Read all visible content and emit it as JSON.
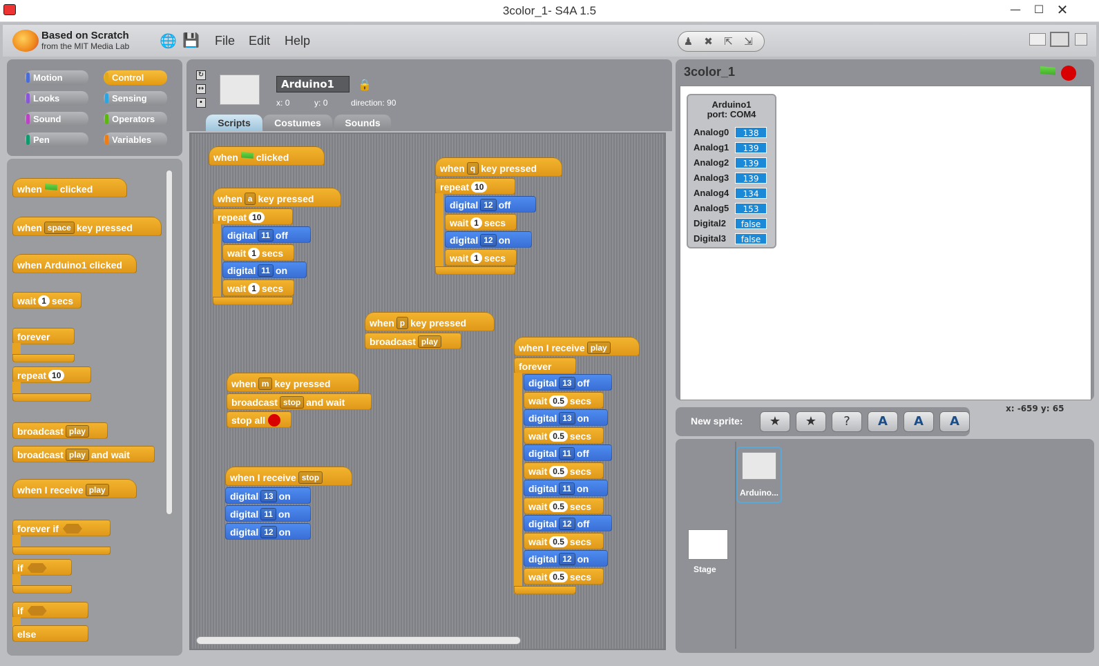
{
  "window": {
    "title": "3color_1- S4A 1.5"
  },
  "menubar": {
    "logo_line1": "Based on Scratch",
    "logo_line2": "from the MIT Media Lab",
    "file": "File",
    "edit": "Edit",
    "help": "Help"
  },
  "categories": {
    "motion": "Motion",
    "control": "Control",
    "looks": "Looks",
    "sensing": "Sensing",
    "sound": "Sound",
    "operators": "Operators",
    "pen": "Pen",
    "variables": "Variables",
    "colors": {
      "motion": "#4a6cd4",
      "control": "#e1a91a",
      "looks": "#8a55d7",
      "sensing": "#2ca5e2",
      "sound": "#bb42c3",
      "operators": "#5cb712",
      "pen": "#0e9a6c",
      "variables": "#ee7d16"
    }
  },
  "sprite": {
    "name": "Arduino1",
    "x_label": "x:",
    "x": "0",
    "y_label": "y:",
    "y": "0",
    "direction_label": "direction:",
    "direction": "90"
  },
  "tabs": {
    "scripts": "Scripts",
    "costumes": "Costumes",
    "sounds": "Sounds"
  },
  "palette": {
    "when": "when",
    "clicked": "clicked",
    "key_pressed": "key pressed",
    "space": "space",
    "when_arduino_clicked": "when Arduino1 clicked",
    "wait": "wait",
    "one": "1",
    "secs": "secs",
    "forever": "forever",
    "repeat": "repeat",
    "ten": "10",
    "broadcast": "broadcast",
    "play": "play",
    "and_wait": "and wait",
    "when_i_receive": "when I receive",
    "forever_if": "forever if",
    "if": "if",
    "else": "else"
  },
  "scripts": {
    "s1": "when",
    "s1b": "clicked",
    "a_when": "when",
    "a_key": "a",
    "a_pressed": "key pressed",
    "repeat": "repeat",
    "ten": "10",
    "digital": "digital",
    "d11": "11",
    "d12": "12",
    "d13": "13",
    "off": "off",
    "on": "on",
    "wait": "wait",
    "one": "1",
    "half": "0.5",
    "secs": "secs",
    "q_key": "q",
    "p_key": "p",
    "m_key": "m",
    "broadcast": "broadcast",
    "play": "play",
    "stop": "stop",
    "and_wait": "and wait",
    "stop_all": "stop all",
    "when_i_receive": "when I receive",
    "forever": "forever"
  },
  "stage": {
    "title": "3color_1",
    "monitor_title": "Arduino1",
    "monitor_port": "port: COM4",
    "rows": [
      {
        "label": "Analog0",
        "value": "138"
      },
      {
        "label": "Analog1",
        "value": "139"
      },
      {
        "label": "Analog2",
        "value": "139"
      },
      {
        "label": "Analog3",
        "value": "139"
      },
      {
        "label": "Analog4",
        "value": "134"
      },
      {
        "label": "Analog5",
        "value": "153"
      },
      {
        "label": "Digital2",
        "value": "false"
      },
      {
        "label": "Digital3",
        "value": "false"
      }
    ],
    "coords": "x: -659   y: 65"
  },
  "new_sprite": {
    "label": "New sprite:"
  },
  "sprites_pane": {
    "stage_label": "Stage",
    "sprite_label": "Arduino..."
  }
}
